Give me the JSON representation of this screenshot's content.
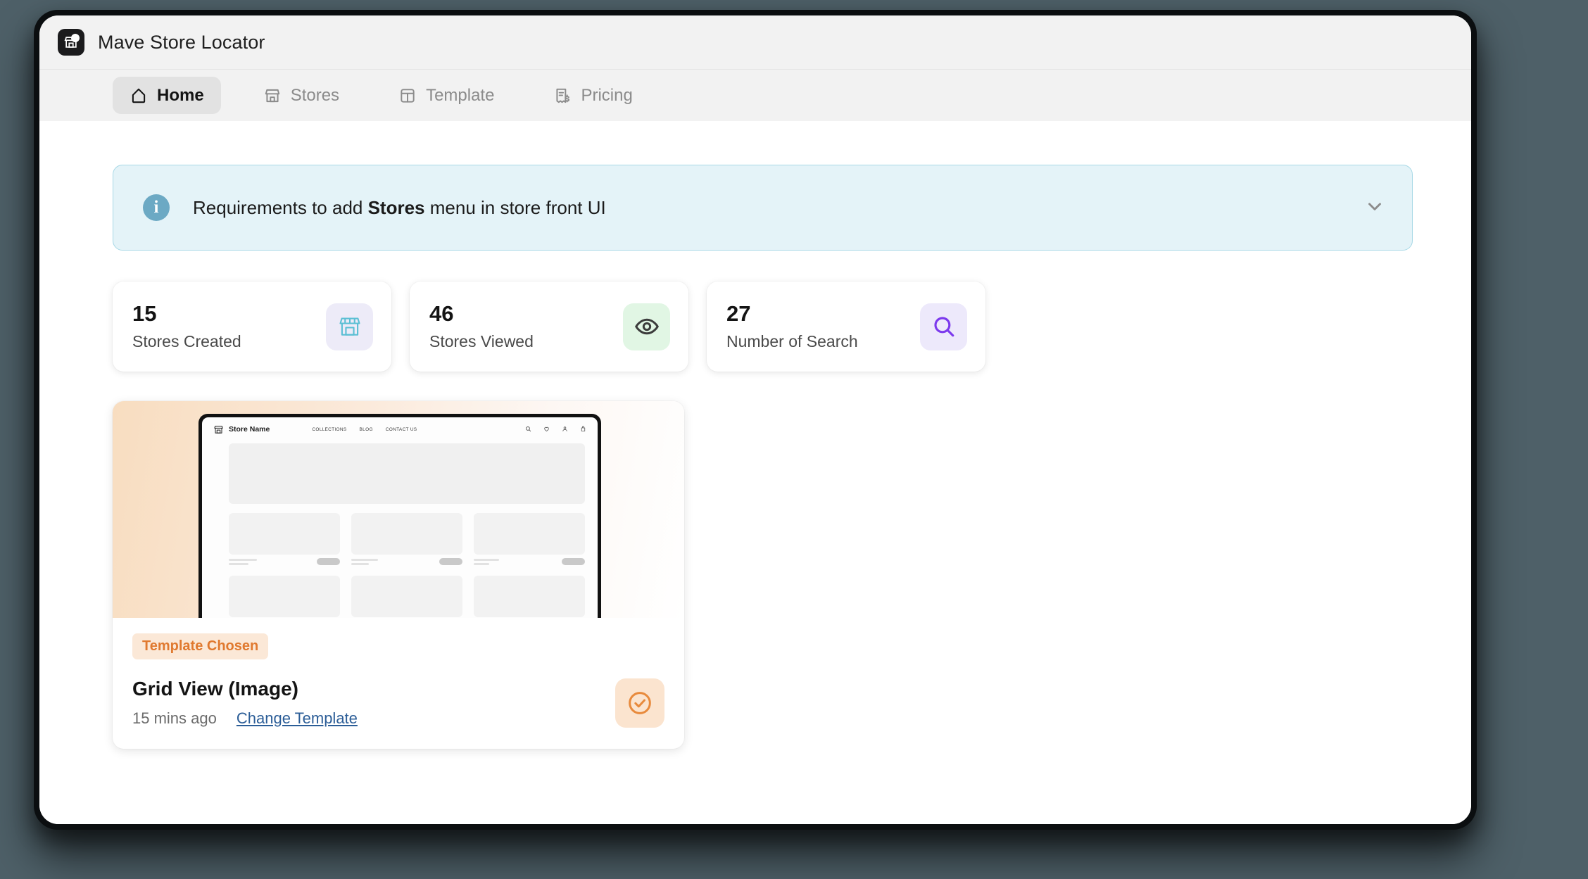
{
  "window": {
    "app_title": "Mave Store Locator",
    "app_icon": "store-app-icon"
  },
  "nav": {
    "items": [
      {
        "label": "Home",
        "icon": "home-icon",
        "active": true
      },
      {
        "label": "Stores",
        "icon": "storefront-icon",
        "active": false
      },
      {
        "label": "Template",
        "icon": "layout-icon",
        "active": false
      },
      {
        "label": "Pricing",
        "icon": "receipt-dollar-icon",
        "active": false
      }
    ]
  },
  "banner": {
    "icon": "info-icon",
    "text_before": "Requirements to add ",
    "text_bold": "Stores",
    "text_after": " menu in store front UI",
    "expand_icon": "chevron-down-icon",
    "background": "#e4f3f8",
    "border": "#a7d8e6",
    "icon_color": "#6ca9c4"
  },
  "stats": [
    {
      "value": "15",
      "label": "Stores Created",
      "icon": "storefront-icon",
      "icon_color": "#5bbfd4",
      "icon_bg": "#edebf8"
    },
    {
      "value": "46",
      "label": "Stores Viewed",
      "icon": "eye-icon",
      "icon_color": "#3c3c3c",
      "icon_bg": "#e1f6e4"
    },
    {
      "value": "27",
      "label": "Number of Search",
      "icon": "search-icon",
      "icon_color": "#7c3aed",
      "icon_bg": "#ede9fb"
    }
  ],
  "template_card": {
    "badge": "Template Chosen",
    "badge_color": "#e0792f",
    "badge_bg": "#fbe8d7",
    "name": "Grid View (Image)",
    "time": "15 mins ago",
    "change_link": "Change Template",
    "link_color": "#2b5d97",
    "check_icon": "check-circle-icon",
    "check_color": "#e88a3c",
    "check_bg": "#fbe4cf",
    "preview": {
      "store_name": "Store Name",
      "nav_links": [
        "COLLECTIONS",
        "BLOG",
        "CONTACT US"
      ],
      "icons": [
        "search-icon",
        "heart-icon",
        "user-icon",
        "bag-icon"
      ],
      "gradient_from": "#f8ddc0",
      "gradient_to": "#ffffff"
    }
  }
}
